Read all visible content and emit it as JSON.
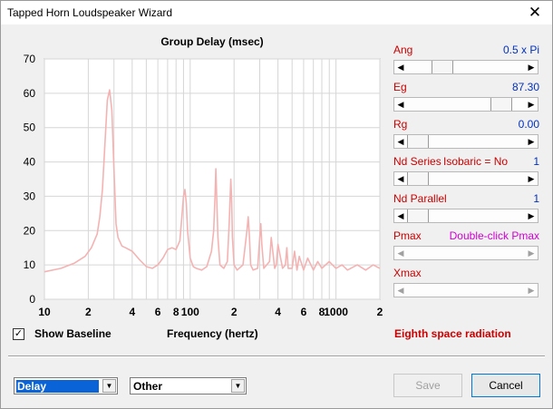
{
  "window": {
    "title": "Tapped Horn Loudspeaker Wizard",
    "close_glyph": "✕"
  },
  "chart_data": {
    "type": "line",
    "title": "Group Delay (msec)",
    "xlabel": "Frequency (hertz)",
    "ylabel": "",
    "x_scale": "log",
    "xlim": [
      10,
      200
    ],
    "ylim": [
      0,
      70
    ],
    "grid": true,
    "y_ticks": [
      "70",
      "60",
      "50",
      "40",
      "30",
      "20",
      "10",
      "0"
    ],
    "x_ticks": [
      {
        "v": 10,
        "label": "10"
      },
      {
        "v": 20,
        "label": "2"
      },
      {
        "v": 40,
        "label": "4"
      },
      {
        "v": 60,
        "label": "6"
      },
      {
        "v": 80,
        "label": "8"
      },
      {
        "v": 100,
        "label": "100"
      },
      {
        "v": 200,
        "label": "2"
      },
      {
        "v": 400,
        "label": "4"
      },
      {
        "v": 600,
        "label": "6"
      },
      {
        "v": 800,
        "label": "8"
      },
      {
        "v": 1000,
        "label": "1000"
      },
      {
        "v": 2000,
        "label": "2"
      }
    ],
    "color": "#f4b3b3",
    "series": [
      {
        "x": [
          10,
          13,
          16,
          19,
          21,
          23,
          24,
          25,
          26,
          27,
          28,
          29,
          30,
          31,
          32,
          34,
          36,
          40,
          45,
          50,
          55,
          60,
          65,
          70,
          75,
          80,
          85,
          88,
          90,
          92,
          94,
          96,
          100,
          105,
          110,
          120,
          130,
          140,
          145,
          148,
          150,
          152,
          155,
          160,
          170,
          180,
          185,
          188,
          190,
          192,
          195,
          200,
          210,
          230,
          245,
          250,
          255,
          260,
          270,
          290,
          300,
          305,
          310,
          320,
          350,
          360,
          380,
          390,
          400,
          430,
          450,
          460,
          470,
          500,
          520,
          540,
          560,
          600,
          640,
          700,
          750,
          800,
          900,
          1000,
          1100,
          1200,
          1400,
          1600,
          1800,
          2000
        ],
        "y": [
          8,
          9,
          10.5,
          12.5,
          15,
          19,
          24,
          32,
          45,
          58,
          61,
          55,
          38,
          22,
          18,
          15.5,
          15,
          14,
          11.5,
          9.5,
          9,
          10,
          12,
          14.5,
          15,
          14.5,
          17,
          25,
          30,
          32,
          28,
          20,
          12,
          9.5,
          9,
          8.5,
          9.5,
          14,
          20,
          30,
          38,
          30,
          18,
          10,
          9,
          11,
          22,
          30,
          35,
          30,
          18,
          10,
          8.5,
          10,
          20,
          24,
          18,
          10,
          8.5,
          9,
          18,
          22,
          16,
          9,
          11,
          18,
          9,
          10,
          16,
          9,
          10,
          15,
          9,
          9,
          14,
          8.5,
          12.5,
          8.5,
          12,
          8.5,
          11,
          9,
          11,
          9,
          10,
          8.5,
          10,
          8.5,
          10,
          9
        ]
      }
    ]
  },
  "right_panel": {
    "ang": {
      "label": "Ang",
      "value": "0.5 x Pi",
      "level": 0.25
    },
    "eg": {
      "label": "Eg",
      "value": "87.30",
      "level": 0.85
    },
    "rg": {
      "label": "Rg",
      "value": "0.00",
      "level": 0.0
    },
    "nd_series": {
      "label": "Nd Series",
      "extra": "Isobaric = No",
      "value": "1",
      "level": 0.0
    },
    "nd_parallel": {
      "label": "Nd  Parallel",
      "value": "1",
      "level": 0.0
    },
    "pmax": {
      "label": "Pmax",
      "value": "Double-click Pmax"
    },
    "xmax": {
      "label": "Xmax"
    }
  },
  "show_baseline": {
    "checked": "✓",
    "label": "Show Baseline"
  },
  "frequency_label": "Frequency (hertz)",
  "radiation_label": "Eighth space radiation",
  "combo_left": {
    "value": "Delay"
  },
  "combo_right": {
    "value": "Other"
  },
  "buttons": {
    "save": "Save",
    "cancel": "Cancel"
  }
}
